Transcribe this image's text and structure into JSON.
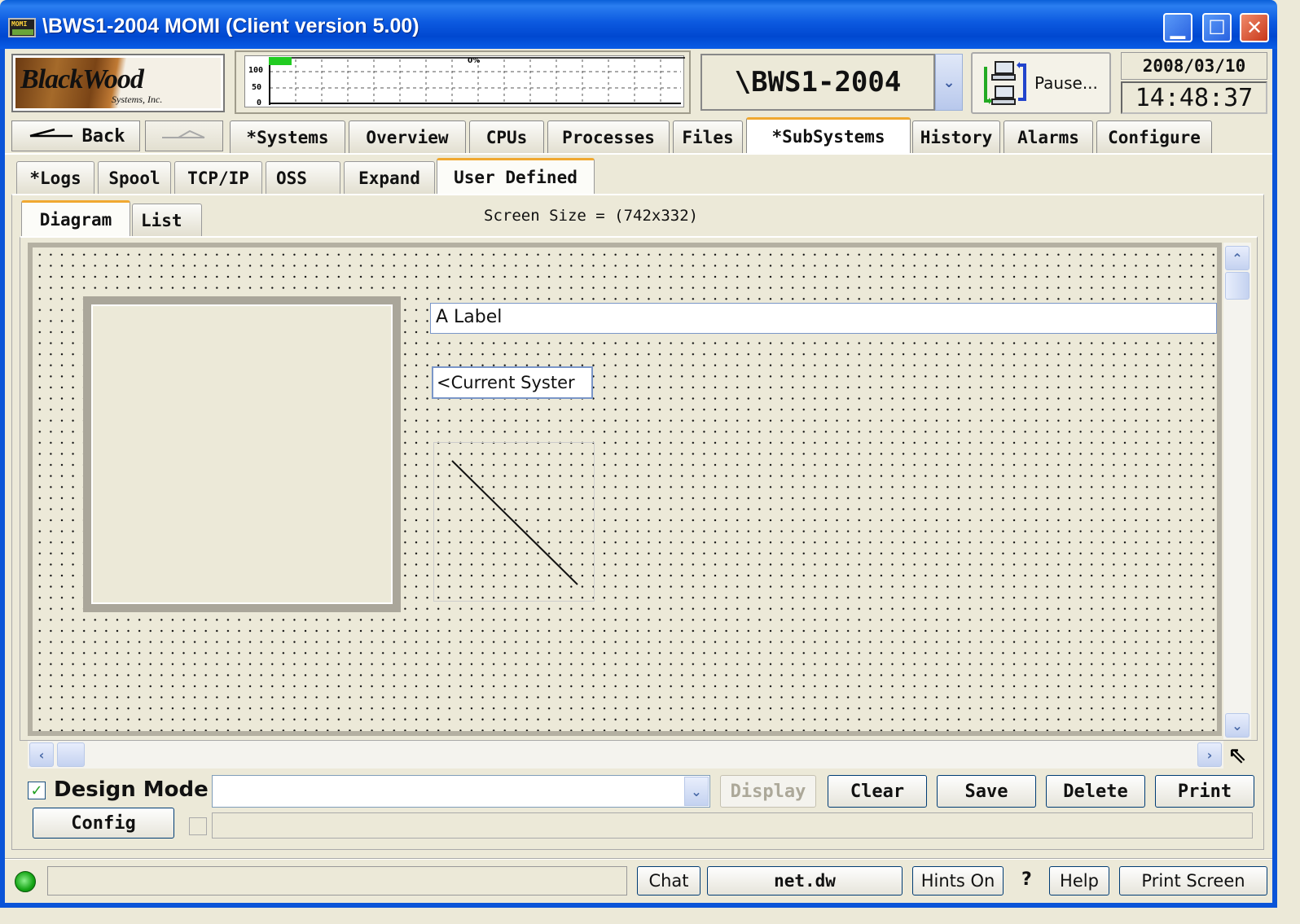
{
  "window": {
    "title": "\\BWS1-2004 MOMI (Client version 5.00)",
    "icon": "MOMI",
    "controls": [
      "minimize-icon",
      "maximize-icon",
      "close-icon"
    ]
  },
  "logo": {
    "name_line1": "BlackWood",
    "name_line2": "Systems, Inc."
  },
  "cpu_graph": {
    "y_ticks": [
      "100",
      "50",
      "0"
    ],
    "percent_label": "0%",
    "level_percent": 5,
    "fill_color": "#22cc22"
  },
  "system": {
    "name": "\\BWS1-2004"
  },
  "pause_button": {
    "label": "Pause...",
    "icon": "network-computers-icon"
  },
  "datetime": {
    "date": "2008/03/10",
    "time": "14:48:37"
  },
  "nav": {
    "back_label": "Back",
    "tabs": [
      {
        "label": "*Systems"
      },
      {
        "label": "Overview"
      },
      {
        "label": "CPUs"
      },
      {
        "label": "Processes"
      },
      {
        "label": "Files"
      },
      {
        "label": "*SubSystems",
        "active": true
      },
      {
        "label": "History"
      },
      {
        "label": "Alarms"
      },
      {
        "label": "Configure"
      }
    ]
  },
  "subtabs": [
    {
      "label": "*Logs"
    },
    {
      "label": "Spool"
    },
    {
      "label": "TCP/IP"
    },
    {
      "label": "OSS"
    },
    {
      "label": "Expand"
    },
    {
      "label": "User Defined",
      "active": true
    }
  ],
  "view_tabs": [
    {
      "label": "Diagram",
      "active": true
    },
    {
      "label": "List"
    }
  ],
  "screen_size": "Screen Size = (742x332)",
  "canvas": {
    "label_widget": "A Label",
    "current_system_widget": "<Current Syster"
  },
  "controls": {
    "design_mode_label": "Design Mode",
    "design_mode_checked": true,
    "diagram_select_value": "",
    "display_label": "Display",
    "clear_label": "Clear",
    "save_label": "Save",
    "delete_label": "Delete",
    "print_label": "Print",
    "config_label": "Config"
  },
  "status_bar": {
    "message": "",
    "chat_label": "Chat",
    "net_label": "net.dw",
    "hints_label": "Hints On",
    "question_label": "?",
    "help_label": "Help",
    "print_screen_label": "Print Screen",
    "led_color": "#15a515"
  }
}
